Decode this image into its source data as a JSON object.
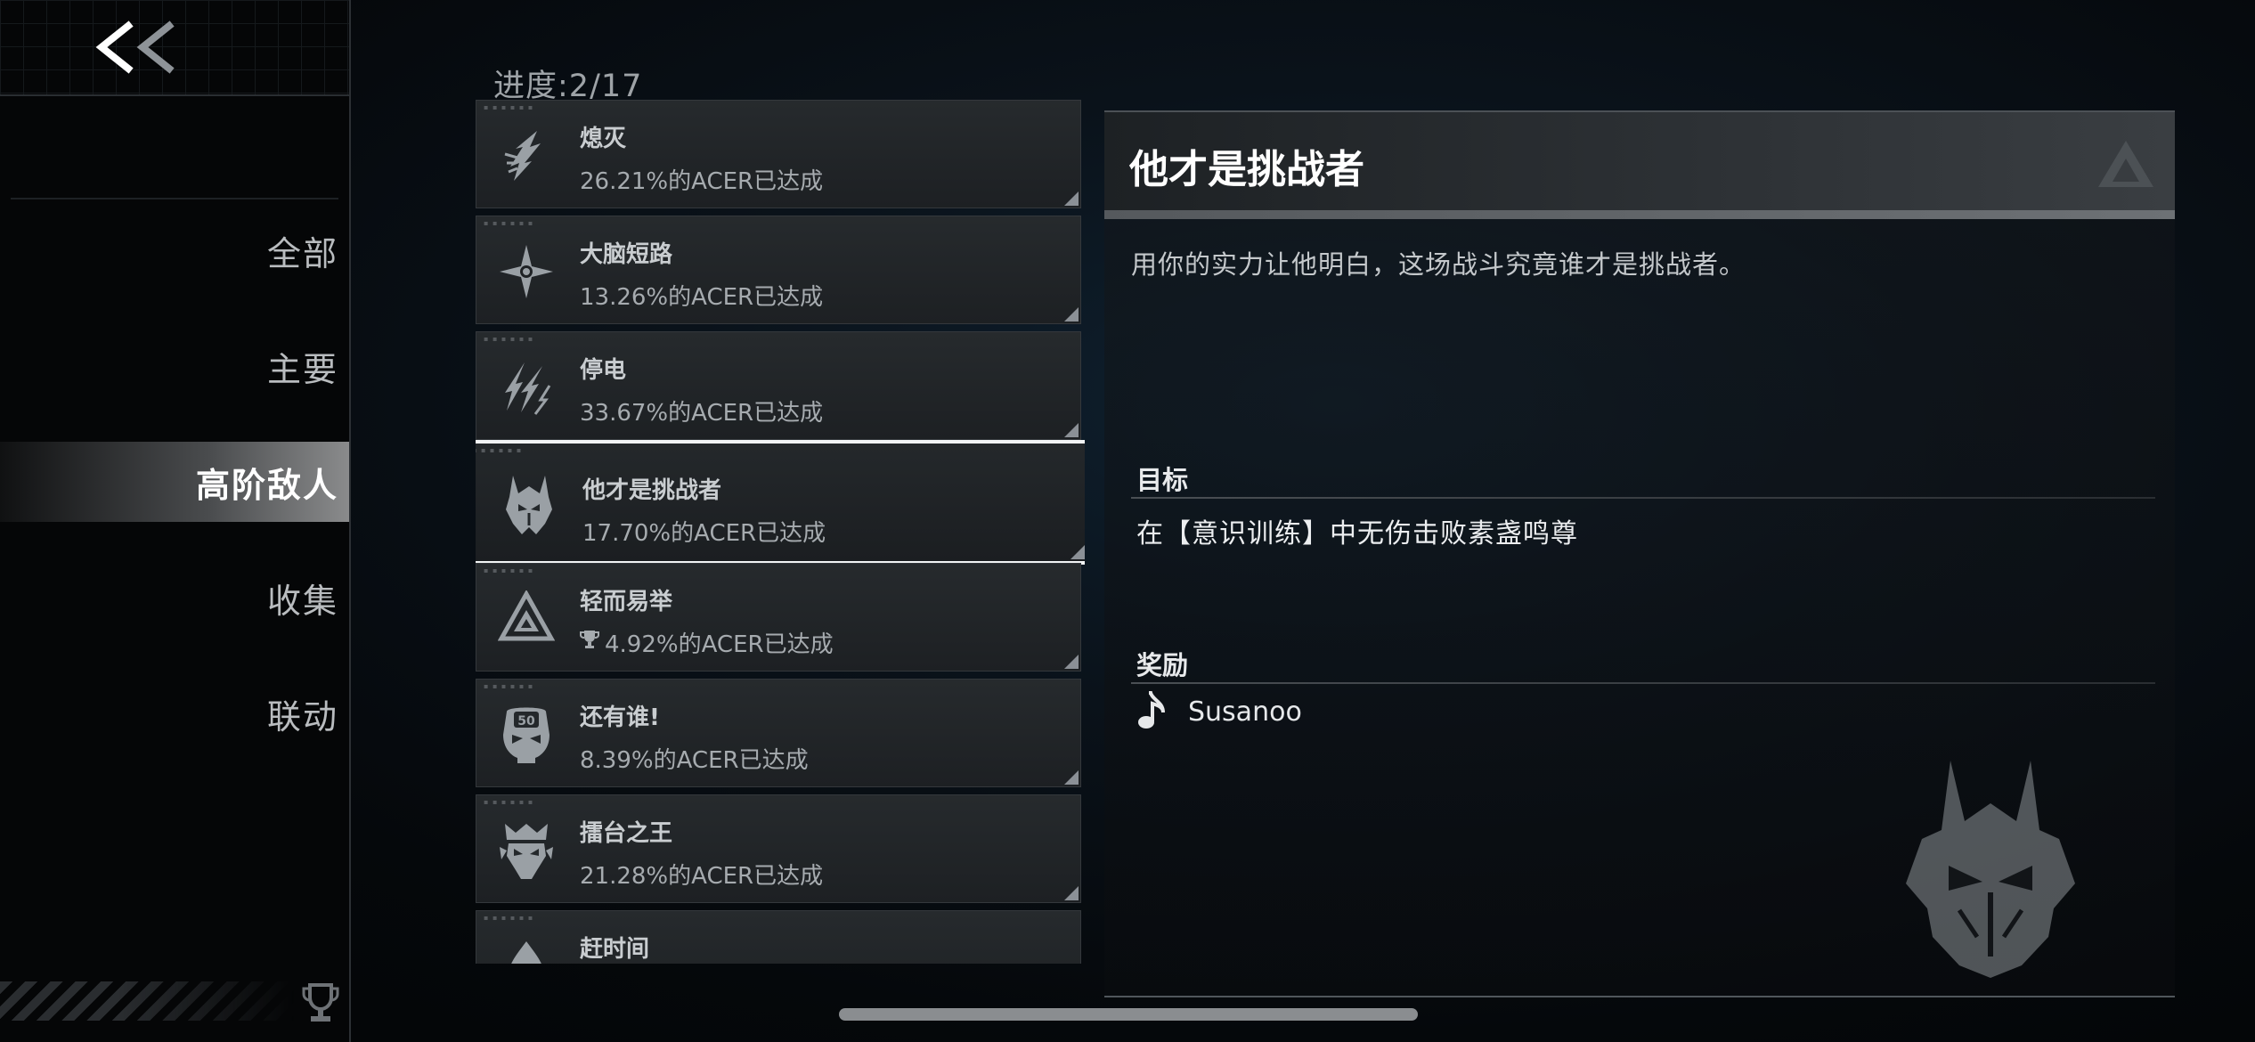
{
  "sidebar": {
    "back_icon": "double-chevron-left-icon",
    "items": [
      {
        "label": "全部",
        "active": false
      },
      {
        "label": "主要",
        "active": false
      },
      {
        "label": "高阶敌人",
        "active": true
      },
      {
        "label": "收集",
        "active": false
      },
      {
        "label": "联动",
        "active": false
      }
    ],
    "footer_icon": "trophy-icon"
  },
  "progress": {
    "label": "进度:",
    "value": "2/17"
  },
  "achievements": [
    {
      "title": "熄灭",
      "rate": "26.21%的ACER已达成",
      "icon": "flame-spike-icon",
      "selected": false
    },
    {
      "title": "大脑短路",
      "rate": "13.26%的ACER已达成",
      "icon": "four-point-star-icon",
      "selected": false
    },
    {
      "title": "停电",
      "rate": "33.67%的ACER已达成",
      "icon": "lightning-claw-icon",
      "selected": false
    },
    {
      "title": "他才是挑战者",
      "rate": "17.70%的ACER已达成",
      "icon": "horned-helmet-icon",
      "selected": true
    },
    {
      "title": "轻而易举",
      "rate": "4.92%的ACER已达成",
      "icon": "triangle-a-icon",
      "trophy_icon": "trophy-icon",
      "selected": false
    },
    {
      "title": "还有谁!",
      "rate": "8.39%的ACER已达成",
      "icon": "skull-50-icon",
      "selected": false
    },
    {
      "title": "擂台之王",
      "rate": "21.28%的ACER已达成",
      "icon": "crowned-mask-icon",
      "selected": false
    },
    {
      "title": "赶时间",
      "rate": "",
      "icon": "clock-drop-icon",
      "selected": false
    }
  ],
  "detail": {
    "title": "他才是挑战者",
    "logo_icon": "triangle-a-logo-icon",
    "description": "用你的实力让他明白，这场战斗究竟谁才是挑战者。",
    "goal_label": "目标",
    "goal_text": "在【意识训练】中无伤击败素盏鸣尊",
    "reward_label": "奖励",
    "reward_icon": "music-note-icon",
    "reward_text": "Susanoo",
    "emblem_icon": "horned-helmet-icon"
  },
  "colors": {
    "background": "#05080b",
    "panel": "#1d2023",
    "selected_border": "#f2f4f5",
    "text_primary": "#ffffff",
    "text_secondary": "#a6abaf"
  }
}
